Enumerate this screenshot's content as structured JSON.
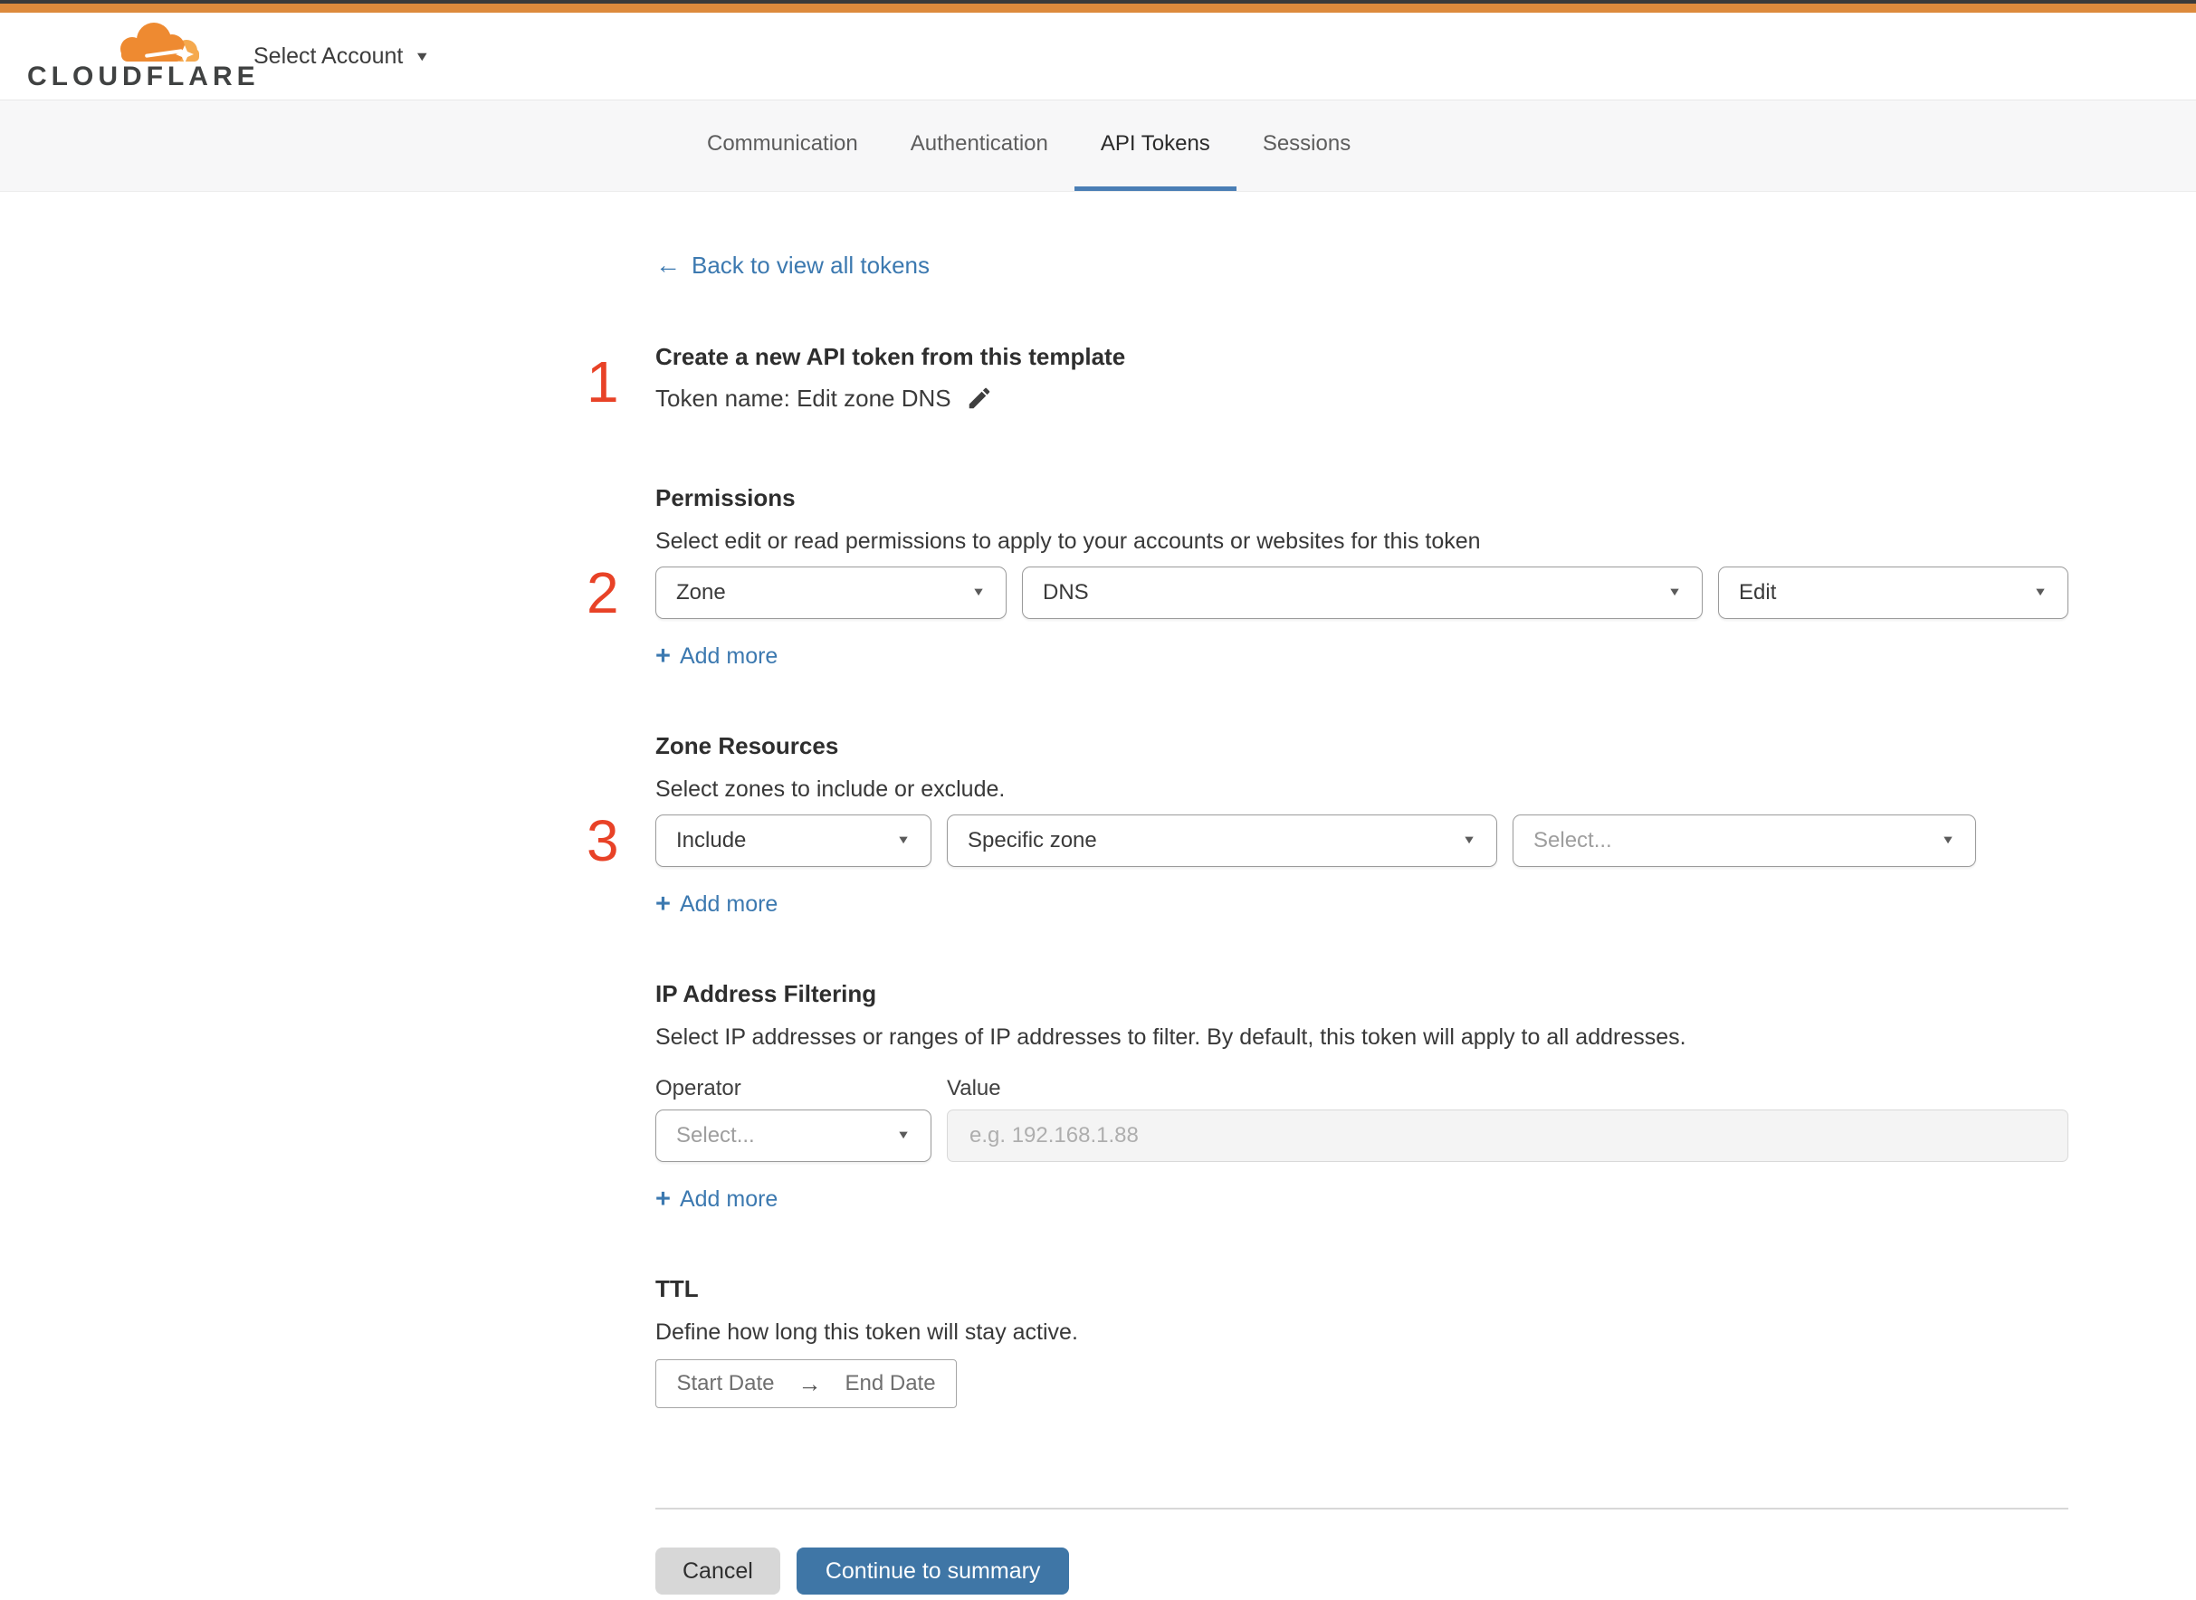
{
  "colors": {
    "top_bar_dark": "#3a3a3a",
    "top_bar_orange": "#dd8a3c",
    "accent_blue": "#3f76a6",
    "link_blue": "#3c79b0",
    "tab_underline_blue": "#4a7eb5",
    "step_red": "#e84227",
    "brand_orange": "#ee8a31",
    "brand_orange_light": "#f5a94e"
  },
  "header": {
    "brand": "CLOUDFLARE",
    "account_selector": "Select Account"
  },
  "tabs": [
    {
      "label": "Communication",
      "active": false
    },
    {
      "label": "Authentication",
      "active": false
    },
    {
      "label": "API Tokens",
      "active": true
    },
    {
      "label": "Sessions",
      "active": false
    }
  ],
  "back_link": {
    "arrow": "←",
    "label": "Back to view all tokens"
  },
  "token_header": {
    "step": "1",
    "title": "Create a new API token from this template",
    "name_line": "Token name: Edit zone DNS"
  },
  "permissions": {
    "step": "2",
    "heading": "Permissions",
    "description": "Select edit or read permissions to apply to your accounts or websites for this token",
    "selects": [
      {
        "value": "Zone"
      },
      {
        "value": "DNS"
      },
      {
        "value": "Edit"
      }
    ],
    "add_more": "Add more"
  },
  "zone_resources": {
    "step": "3",
    "heading": "Zone Resources",
    "description": "Select zones to include or exclude.",
    "selects": [
      {
        "value": "Include"
      },
      {
        "value": "Specific zone"
      },
      {
        "value": "Select..."
      }
    ],
    "add_more": "Add more"
  },
  "ip_filtering": {
    "heading": "IP Address Filtering",
    "description": "Select IP addresses or ranges of IP addresses to filter. By default, this token will apply to all addresses.",
    "operator_label": "Operator",
    "value_label": "Value",
    "operator_select": "Select...",
    "value_placeholder": "e.g. 192.168.1.88",
    "add_more": "Add more"
  },
  "ttl": {
    "heading": "TTL",
    "description": "Define how long this token will stay active.",
    "start_label": "Start Date",
    "arrow": "→",
    "end_label": "End Date"
  },
  "footer": {
    "cancel": "Cancel",
    "continue": "Continue to summary"
  },
  "icons": {
    "plus": "+",
    "caret": "▼"
  }
}
